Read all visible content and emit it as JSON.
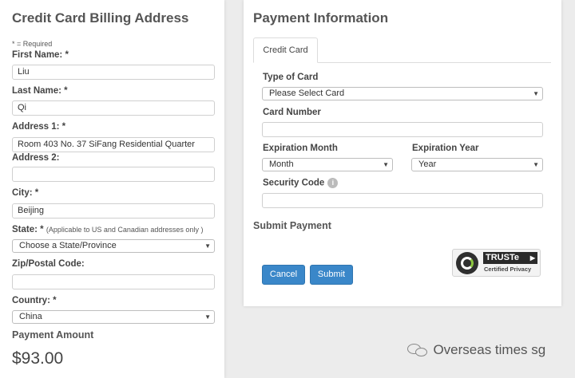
{
  "billing": {
    "title": "Credit Card Billing Address",
    "required_note": "* = Required",
    "first_name_label": "First Name: *",
    "first_name_value": "Liu",
    "last_name_label": "Last Name: *",
    "last_name_value": "Qi",
    "address1_label": "Address 1: *",
    "address1_value": "Room 403  No. 37  SiFang Residential Quarter",
    "address2_label": "Address 2:",
    "address2_value": "",
    "city_label": "City: *",
    "city_value": "Beijing",
    "state_label": "State: *",
    "state_note": "(Applicable to US and Canadian addresses only )",
    "state_value": "Choose a State/Province",
    "zip_label": "Zip/Postal Code:",
    "zip_value": "",
    "country_label": "Country: *",
    "country_value": "China",
    "amount_label": "Payment Amount",
    "amount_value": "$93.00"
  },
  "payment": {
    "title": "Payment Information",
    "tab_label": "Credit Card",
    "card_type_label": "Type of Card",
    "card_type_value": "Please Select Card",
    "card_number_label": "Card Number",
    "card_number_value": "",
    "exp_month_label": "Expiration Month",
    "exp_month_value": "Month",
    "exp_year_label": "Expiration Year",
    "exp_year_value": "Year",
    "security_code_label": "Security Code",
    "security_code_value": "",
    "submit_heading": "Submit Payment",
    "cancel_label": "Cancel",
    "submit_label": "Submit"
  },
  "truste": {
    "name": "TRUSTe",
    "tagline": "Certified Privacy"
  },
  "watermark": {
    "text": "Overseas times sg"
  }
}
